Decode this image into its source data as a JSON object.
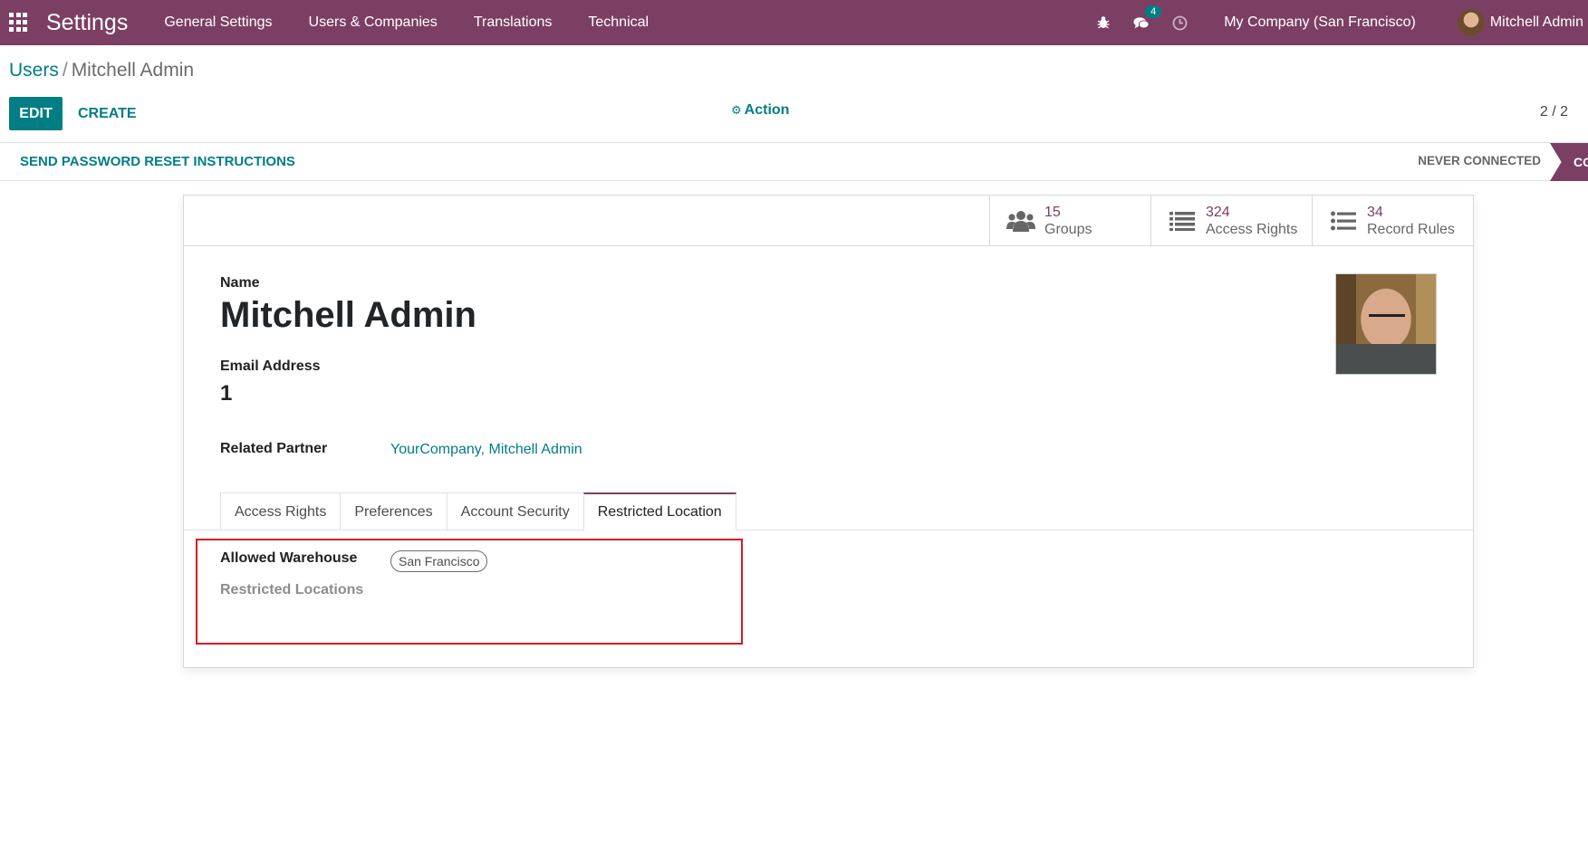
{
  "navbar": {
    "app_title": "Settings",
    "menu": [
      "General Settings",
      "Users & Companies",
      "Translations",
      "Technical"
    ],
    "messages_badge": "4",
    "company": "My Company (San Francisco)",
    "user": "Mitchell Admin",
    "bg_color": "#7c3f64"
  },
  "breadcrumb": {
    "parent": "Users",
    "separator": "/",
    "current": "Mitchell Admin"
  },
  "controls": {
    "edit": "EDIT",
    "create": "CREATE",
    "action": "Action",
    "pager": "2 / 2"
  },
  "statusbar": {
    "reset": "SEND PASSWORD RESET INSTRUCTIONS",
    "never_connected": "NEVER CONNECTED",
    "stage": "CO"
  },
  "smart_buttons": [
    {
      "value": "15",
      "label": "Groups",
      "icon": "users-icon"
    },
    {
      "value": "324",
      "label": "Access Rights",
      "icon": "list-icon"
    },
    {
      "value": "34",
      "label": "Record Rules",
      "icon": "list-icon"
    }
  ],
  "form": {
    "name_label": "Name",
    "name": "Mitchell Admin",
    "email_label": "Email Address",
    "email": "1",
    "partner_label": "Related Partner",
    "partner": "YourCompany, Mitchell Admin"
  },
  "tabs": [
    "Access Rights",
    "Preferences",
    "Account Security",
    "Restricted Location"
  ],
  "active_tab": "Restricted Location",
  "restricted": {
    "warehouse_label": "Allowed Warehouse",
    "warehouse_tag": "San Francisco",
    "locations_label": "Restricted Locations"
  },
  "colors": {
    "accent": "#017e84",
    "brand": "#7c3f64",
    "highlight": "#e0141e"
  }
}
